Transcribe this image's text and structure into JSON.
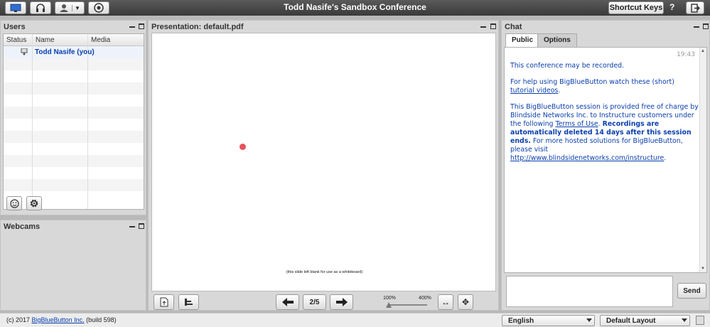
{
  "topbar": {
    "title": "Todd Nasife's Sandbox Conference",
    "shortcut_keys_label": "Shortcut Keys",
    "help_label": "?"
  },
  "users": {
    "title": "Users",
    "columns": [
      "Status",
      "Name",
      "Media"
    ],
    "rows": [
      {
        "name": "Todd Nasife (you)",
        "status_icon": "presenter-icon"
      }
    ]
  },
  "webcams": {
    "title": "Webcams"
  },
  "presentation": {
    "title": "Presentation: default.pdf",
    "slide_caption": "(this slide left blank for use as a whiteboard)",
    "page_indicator": "2/5",
    "zoom_min": "100%",
    "zoom_max": "400%",
    "zoom_level": 0.0
  },
  "chat": {
    "title": "Chat",
    "tabs": [
      "Public",
      "Options"
    ],
    "timestamp": "19:43",
    "messages": {
      "m1": "This conference may be recorded.",
      "m2_prefix": "For help using BigBlueButton watch these (short) ",
      "m2_link": "tutorial videos",
      "m2_suffix": ".",
      "m3_a": "This BigBlueButton session is provided free of charge by Blindside Networks Inc. to Instructure customers under the following ",
      "m3_link": "Terms of Use",
      "m3_b": ".  ",
      "m3_bold": "Recordings are automatically deleted 14 days after this session ends.",
      "m3_c": "  For more hosted solutions for BigBlueButton, please visit ",
      "m3_url": "http://www.blindsidenetworks.com/instructure",
      "m3_d": "."
    },
    "send_label": "Send"
  },
  "footer": {
    "copyright_prefix": "(c) 2017 ",
    "copyright_link": "BigBlueButton Inc.",
    "copyright_suffix": " (build 598)",
    "language": "English",
    "layout": "Default Layout"
  },
  "colors": {
    "accent": "#0a3fae",
    "cursor": "#e8525a"
  }
}
